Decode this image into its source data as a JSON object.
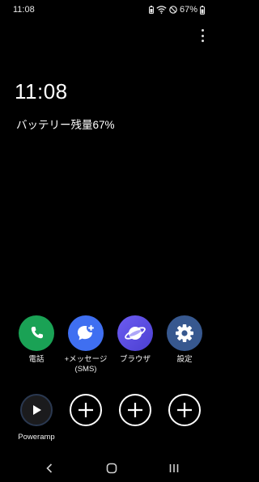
{
  "status_bar": {
    "time": "11:08",
    "battery_percent": "67%",
    "icons": [
      "battery-saver-icon",
      "wifi-icon",
      "do-not-disturb-icon",
      "battery-icon"
    ]
  },
  "lock": {
    "clock": "11:08",
    "battery_text": "バッテリー残量67%"
  },
  "apps_row1": [
    {
      "label": "電話",
      "sub": "",
      "icon": "phone-icon",
      "color": "#1aa255"
    },
    {
      "label": "+メッセージ",
      "sub": "(SMS)",
      "icon": "message-plus-icon",
      "color": "#3f6ff1"
    },
    {
      "label": "ブラウザ",
      "sub": "",
      "icon": "browser-planet-icon",
      "color": "#6c5cf2"
    },
    {
      "label": "設定",
      "sub": "",
      "icon": "gear-icon",
      "color": "#37588f"
    }
  ],
  "apps_row2": [
    {
      "label": "Poweramp",
      "icon": "play-icon"
    },
    {
      "label": "",
      "icon": "plus-icon"
    },
    {
      "label": "",
      "icon": "plus-icon"
    },
    {
      "label": "",
      "icon": "plus-icon"
    }
  ],
  "nav": {
    "back": "back-icon",
    "home": "home-icon",
    "recents": "recents-icon"
  }
}
